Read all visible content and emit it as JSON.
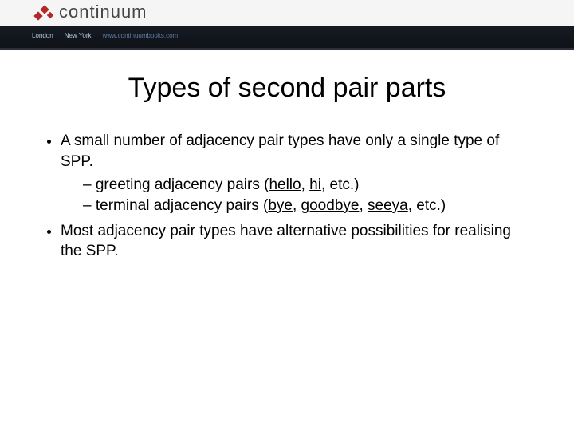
{
  "banner": {
    "brand": "continuum",
    "locations": [
      "London",
      "New York"
    ],
    "url": "www.continuumbooks.com"
  },
  "title": "Types of second pair parts",
  "bullets": {
    "b1": "A small number of adjacency pair types have only a single type of SPP.",
    "b1a_pre": "greeting adjacency pairs (",
    "b1a_u1": "hello",
    "b1a_u2": "hi",
    "b1a_post": ", etc.)",
    "b1b_pre": "terminal adjacency pairs (",
    "b1b_u1": "bye",
    "b1b_u2": "goodbye",
    "b1b_u3": "seeya",
    "b1b_post": ", etc.)",
    "b2": "Most adjacency pair types have alternative possibilities for realising the SPP."
  },
  "sep": ", "
}
